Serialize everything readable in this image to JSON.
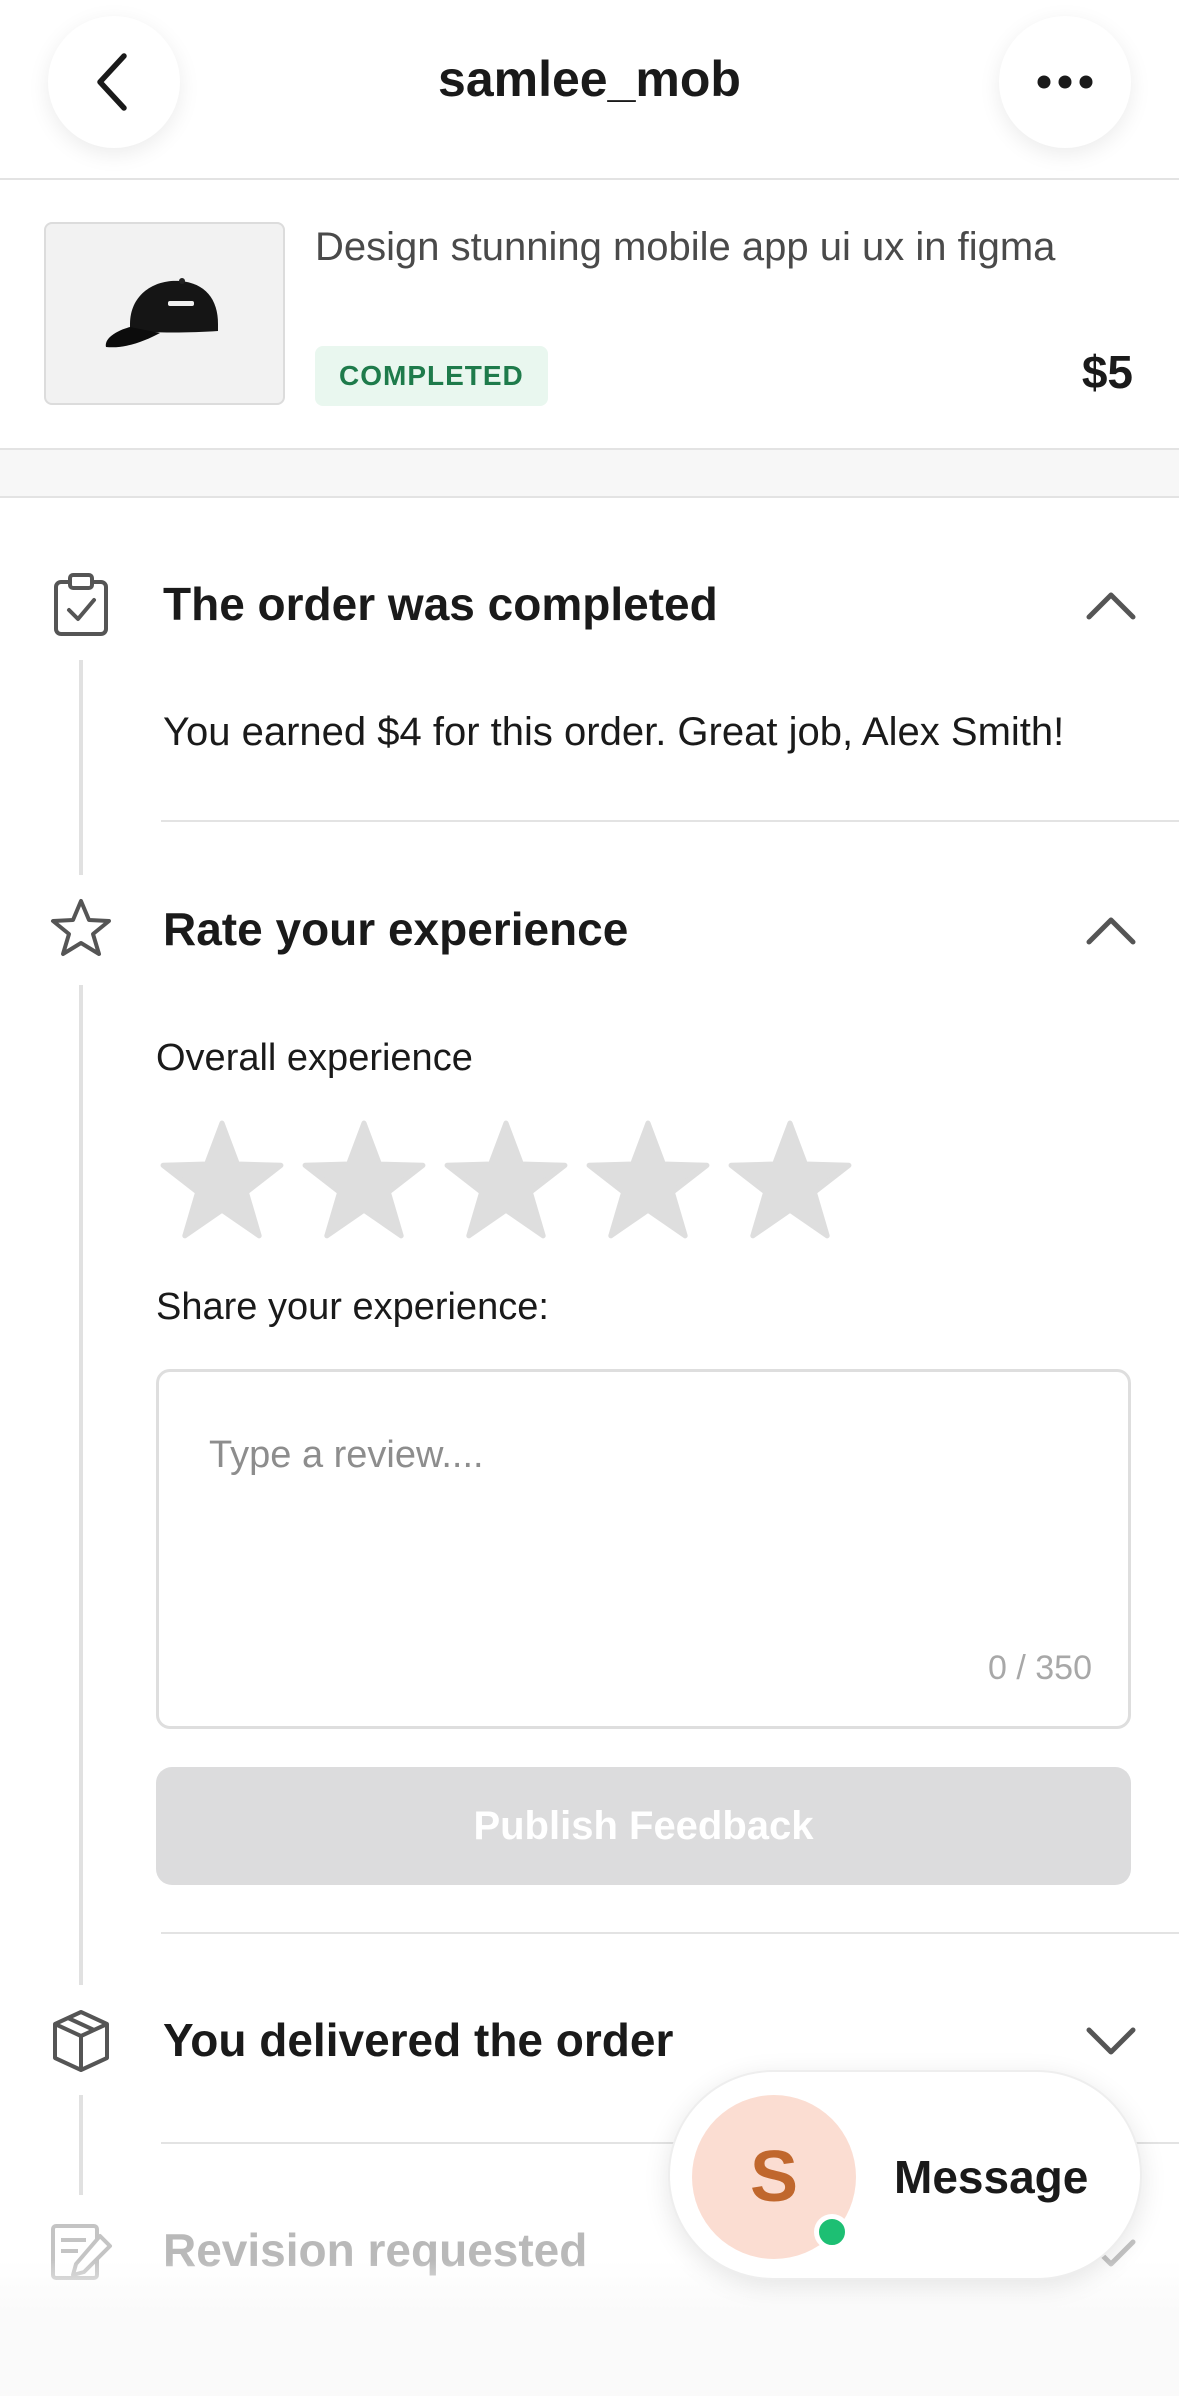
{
  "header": {
    "title": "samlee_mob",
    "back_icon": "chevron-left-icon",
    "more_icon": "more-horizontal-icon"
  },
  "order": {
    "gig_title": "Design stunning mobile app ui ux in figma",
    "status": "COMPLETED",
    "price": "$5",
    "status_color": "#1e7b4b",
    "status_bg": "#e9f7ef"
  },
  "timeline": {
    "completed": {
      "title": "The order was completed",
      "icon": "clipboard-check-icon",
      "message": "You earned $4 for this order. Great job, Alex Smith!",
      "expanded": true
    },
    "rate": {
      "title": "Rate your experience",
      "icon": "star-outline-icon",
      "expanded": true,
      "overall_label": "Overall experience",
      "rating": 0,
      "max_rating": 5,
      "share_label": "Share your experience:",
      "review_value": "",
      "review_placeholder": "Type a review....",
      "char_count": "0 / 350",
      "publish_label": "Publish Feedback"
    },
    "delivered": {
      "title": "You delivered the order",
      "icon": "package-icon",
      "expanded": false
    },
    "revision": {
      "title": "Revision requested",
      "icon": "edit-note-icon",
      "expanded": false
    }
  },
  "message_button": {
    "avatar_initial": "S",
    "label": "Message",
    "online": true,
    "avatar_bg": "#fbddd2",
    "online_color": "#1dbf73"
  }
}
